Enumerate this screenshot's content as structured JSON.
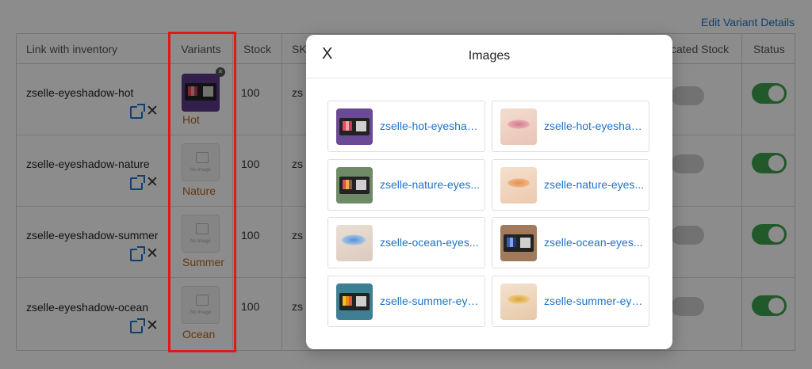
{
  "page": {
    "edit_variant_link": "Edit Variant Details",
    "columns": {
      "link": "Link with inventory",
      "variants": "Variants",
      "stock": "Stock",
      "sku": "SK",
      "allocated": "cated Stock",
      "status": "Status"
    },
    "rows": [
      {
        "link": "zselle-eyeshadow-hot",
        "variant": "Hot",
        "stock": "100",
        "sku": "zs",
        "has_image": true
      },
      {
        "link": "zselle-eyeshadow-nature",
        "variant": "Nature",
        "stock": "100",
        "sku": "zs",
        "has_image": false
      },
      {
        "link": "zselle-eyeshadow-summer",
        "variant": "Summer",
        "stock": "100",
        "sku": "zs",
        "has_image": false
      },
      {
        "link": "zselle-eyeshadow-ocean",
        "variant": "Ocean",
        "stock": "100",
        "sku": "zs",
        "has_image": false
      }
    ],
    "no_image_text": "No Image",
    "colors": {
      "link": "#1f73c9",
      "variant_label": "#b5651d",
      "toggle_on": "#3fa34d",
      "highlight": "#e01818"
    }
  },
  "modal": {
    "close": "X",
    "title": "Images",
    "images": [
      {
        "name": "zselle-hot-eyeshad...",
        "thumb": "palette-purple"
      },
      {
        "name": "zselle-hot-eyeshad...",
        "thumb": "eye-pink"
      },
      {
        "name": "zselle-nature-eyes...",
        "thumb": "palette-green"
      },
      {
        "name": "zselle-nature-eyes...",
        "thumb": "eye-peach"
      },
      {
        "name": "zselle-ocean-eyes...",
        "thumb": "eye-blue"
      },
      {
        "name": "zselle-ocean-eyes...",
        "thumb": "palette-brown"
      },
      {
        "name": "zselle-summer-eye...",
        "thumb": "palette-teal"
      },
      {
        "name": "zselle-summer-eye...",
        "thumb": "eye-gold"
      }
    ]
  }
}
